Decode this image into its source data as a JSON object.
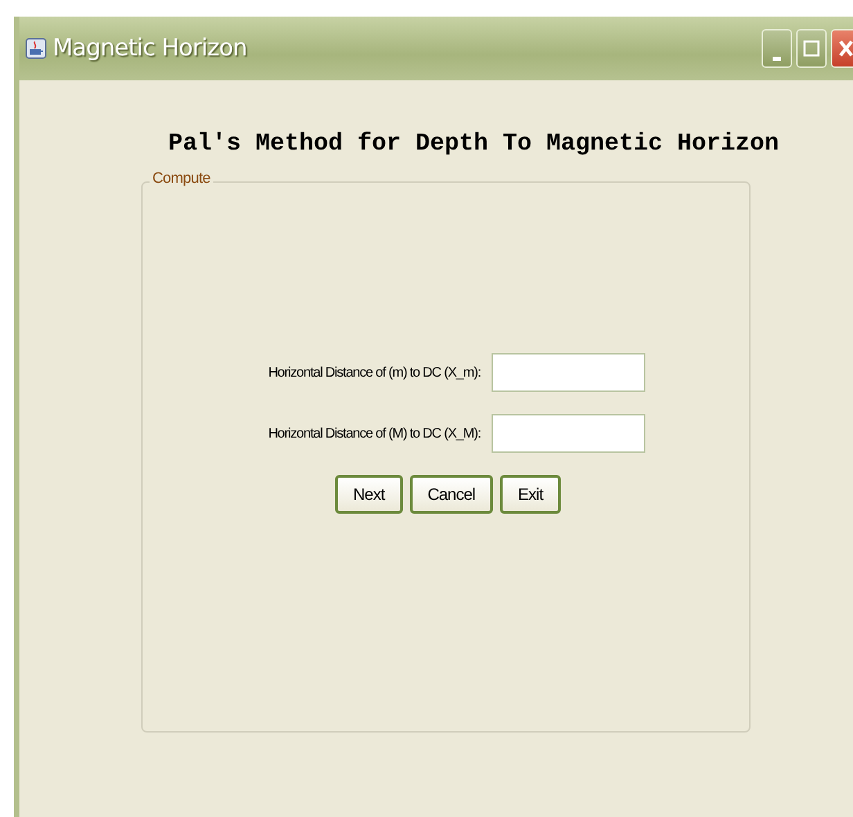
{
  "window": {
    "title": "Magnetic Horizon"
  },
  "heading": "Pal's Method for Depth To Magnetic Horizon",
  "group": {
    "title": "Compute"
  },
  "fields": [
    {
      "label": "Horizontal Distance of (m) to DC (X_m):"
    },
    {
      "label": "Horizontal Distance of (M) to DC (X_M):"
    }
  ],
  "buttons": [
    "Next",
    "Cancel",
    "Exit"
  ]
}
